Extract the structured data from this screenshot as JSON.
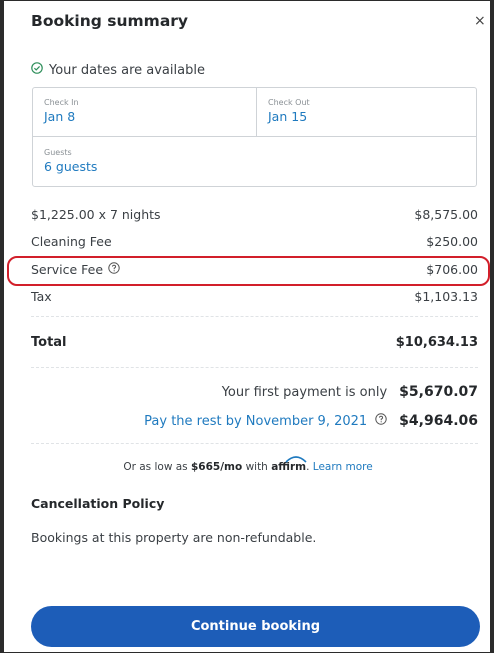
{
  "header": {
    "title": "Booking summary",
    "close_glyph": "×"
  },
  "availability": {
    "text": "Your dates are available",
    "icon": "check-circle-icon"
  },
  "dates": {
    "check_in_label": "Check In",
    "check_in_value": "Jan 8",
    "check_out_label": "Check Out",
    "check_out_value": "Jan 15",
    "guests_label": "Guests",
    "guests_value": "6 guests"
  },
  "fees": [
    {
      "label": "$1,225.00 x 7 nights",
      "amount": "$8,575.00"
    },
    {
      "label": "Cleaning Fee",
      "amount": "$250.00"
    },
    {
      "label": "Service Fee",
      "amount": "$706.00"
    },
    {
      "label": "Tax",
      "amount": "$1,103.13"
    }
  ],
  "total": {
    "label": "Total",
    "amount": "$10,634.13"
  },
  "payments": {
    "first_label": "Your first payment is only",
    "first_amount": "$5,670.07",
    "rest_label": "Pay the rest by November 9, 2021",
    "rest_amount": "$4,964.06"
  },
  "affirm": {
    "prefix": "Or as low as",
    "monthly": "$665/mo",
    "with": "with",
    "brand": "affirm",
    "learn_more": "Learn more"
  },
  "policy": {
    "heading": "Cancellation Policy",
    "text": "Bookings at this property are non-refundable."
  },
  "cta": {
    "label": "Continue booking"
  },
  "colors": {
    "accent": "#1d5db8",
    "link": "#1f7abf",
    "highlight": "#d21f2a",
    "success": "#2f8f5b"
  }
}
